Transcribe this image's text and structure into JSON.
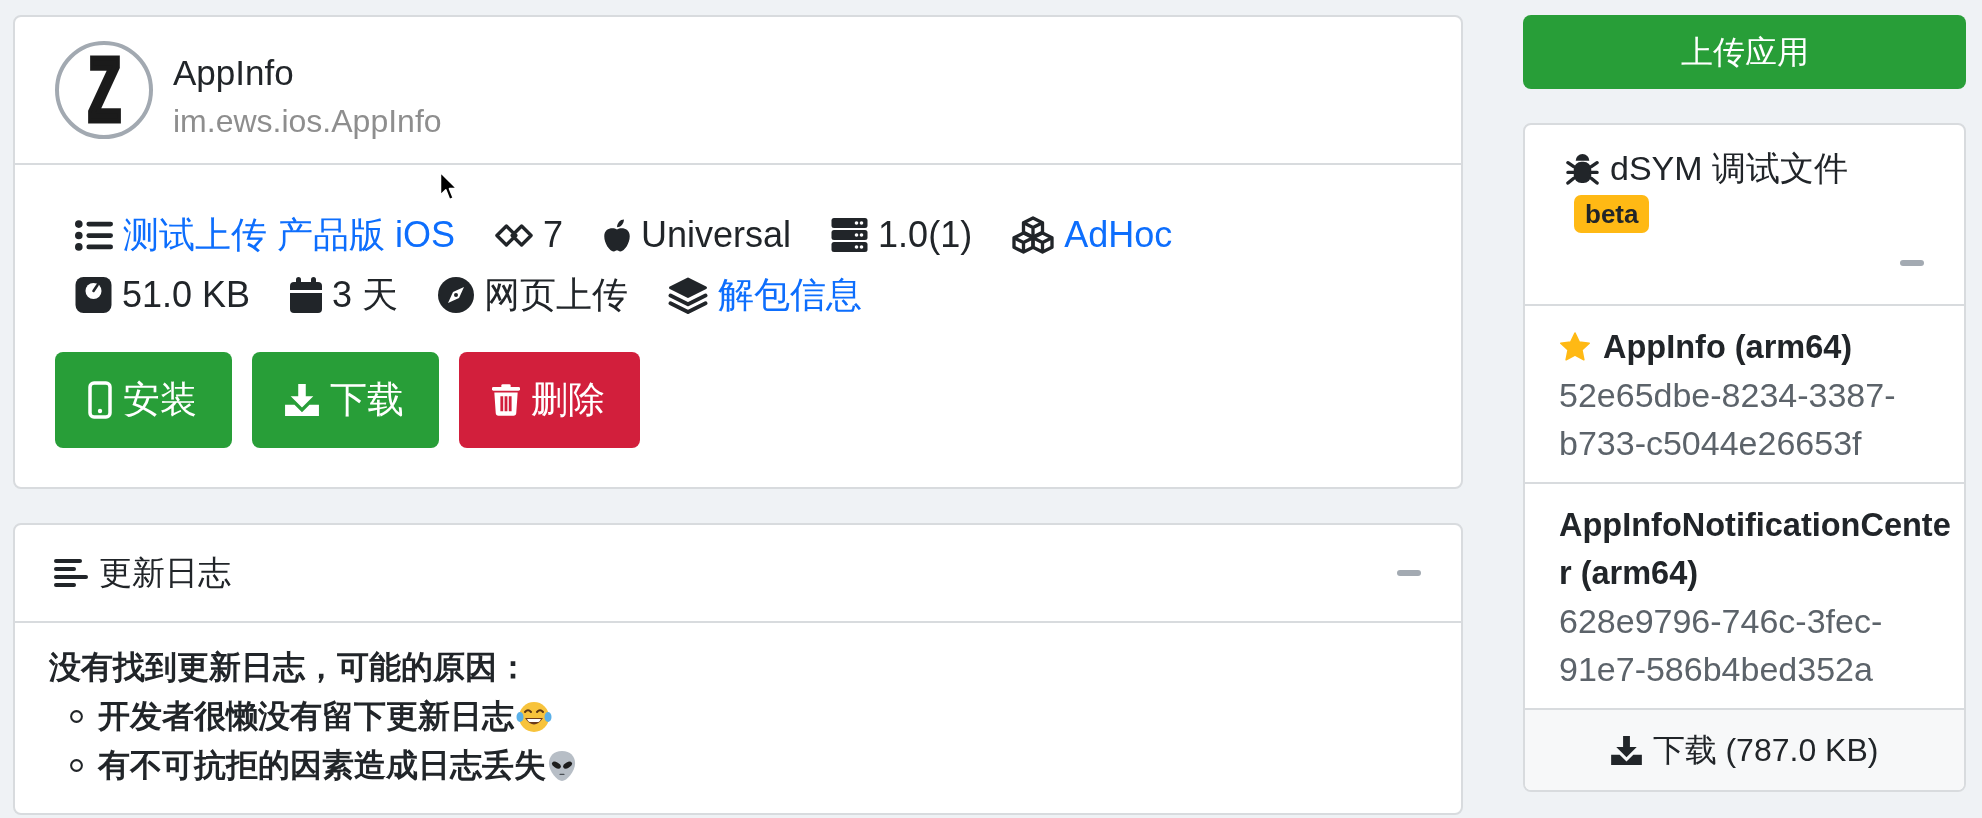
{
  "app": {
    "logo_text": "Z",
    "name": "AppInfo",
    "bundle_id": "im.ews.ios.AppInfo"
  },
  "info_rows": [
    {
      "items": [
        {
          "kind": "channel",
          "text": "测试上传 产品版 iOS",
          "link": true
        },
        {
          "kind": "build",
          "text": "7",
          "link": false
        },
        {
          "kind": "platform",
          "text": "Universal",
          "link": false
        },
        {
          "kind": "version",
          "text": "1.0(1)",
          "link": false
        },
        {
          "kind": "distribution",
          "text": "AdHoc",
          "link": true
        }
      ]
    },
    {
      "items": [
        {
          "kind": "size",
          "text": "51.0 KB",
          "link": false
        },
        {
          "kind": "age",
          "text": "3 天",
          "link": false
        },
        {
          "kind": "source",
          "text": "网页上传",
          "link": false
        },
        {
          "kind": "unpack",
          "text": "解包信息",
          "link": true
        }
      ]
    }
  ],
  "actions": [
    {
      "kind": "install",
      "label": "安装",
      "color": "#289e38"
    },
    {
      "kind": "download",
      "label": "下载",
      "color": "#289e38"
    },
    {
      "kind": "delete",
      "label": "删除",
      "color": "#d21f3c"
    }
  ],
  "changelog": {
    "title": "更新日志",
    "expanded": true,
    "message": "没有找到更新日志，可能的原因：",
    "reasons": [
      "开发者很懒没有留下更新日志",
      "有不可抗拒的因素造成日志丢失"
    ]
  },
  "upload_button": "上传应用",
  "dsym": {
    "title": "dSYM 调试文件",
    "badge": "beta",
    "expanded": true,
    "files": [
      {
        "name": "AppInfo (arm64)",
        "uuid": "52e65dbe-8234-3387-b733-c5044e26653f",
        "starred": true
      },
      {
        "name": "AppInfoNotificationCenter (arm64)",
        "uuid": "628e9796-746c-3fec-91e7-586b4bed352a",
        "starred": false
      }
    ],
    "download": "下载 (787.0 KB)"
  }
}
